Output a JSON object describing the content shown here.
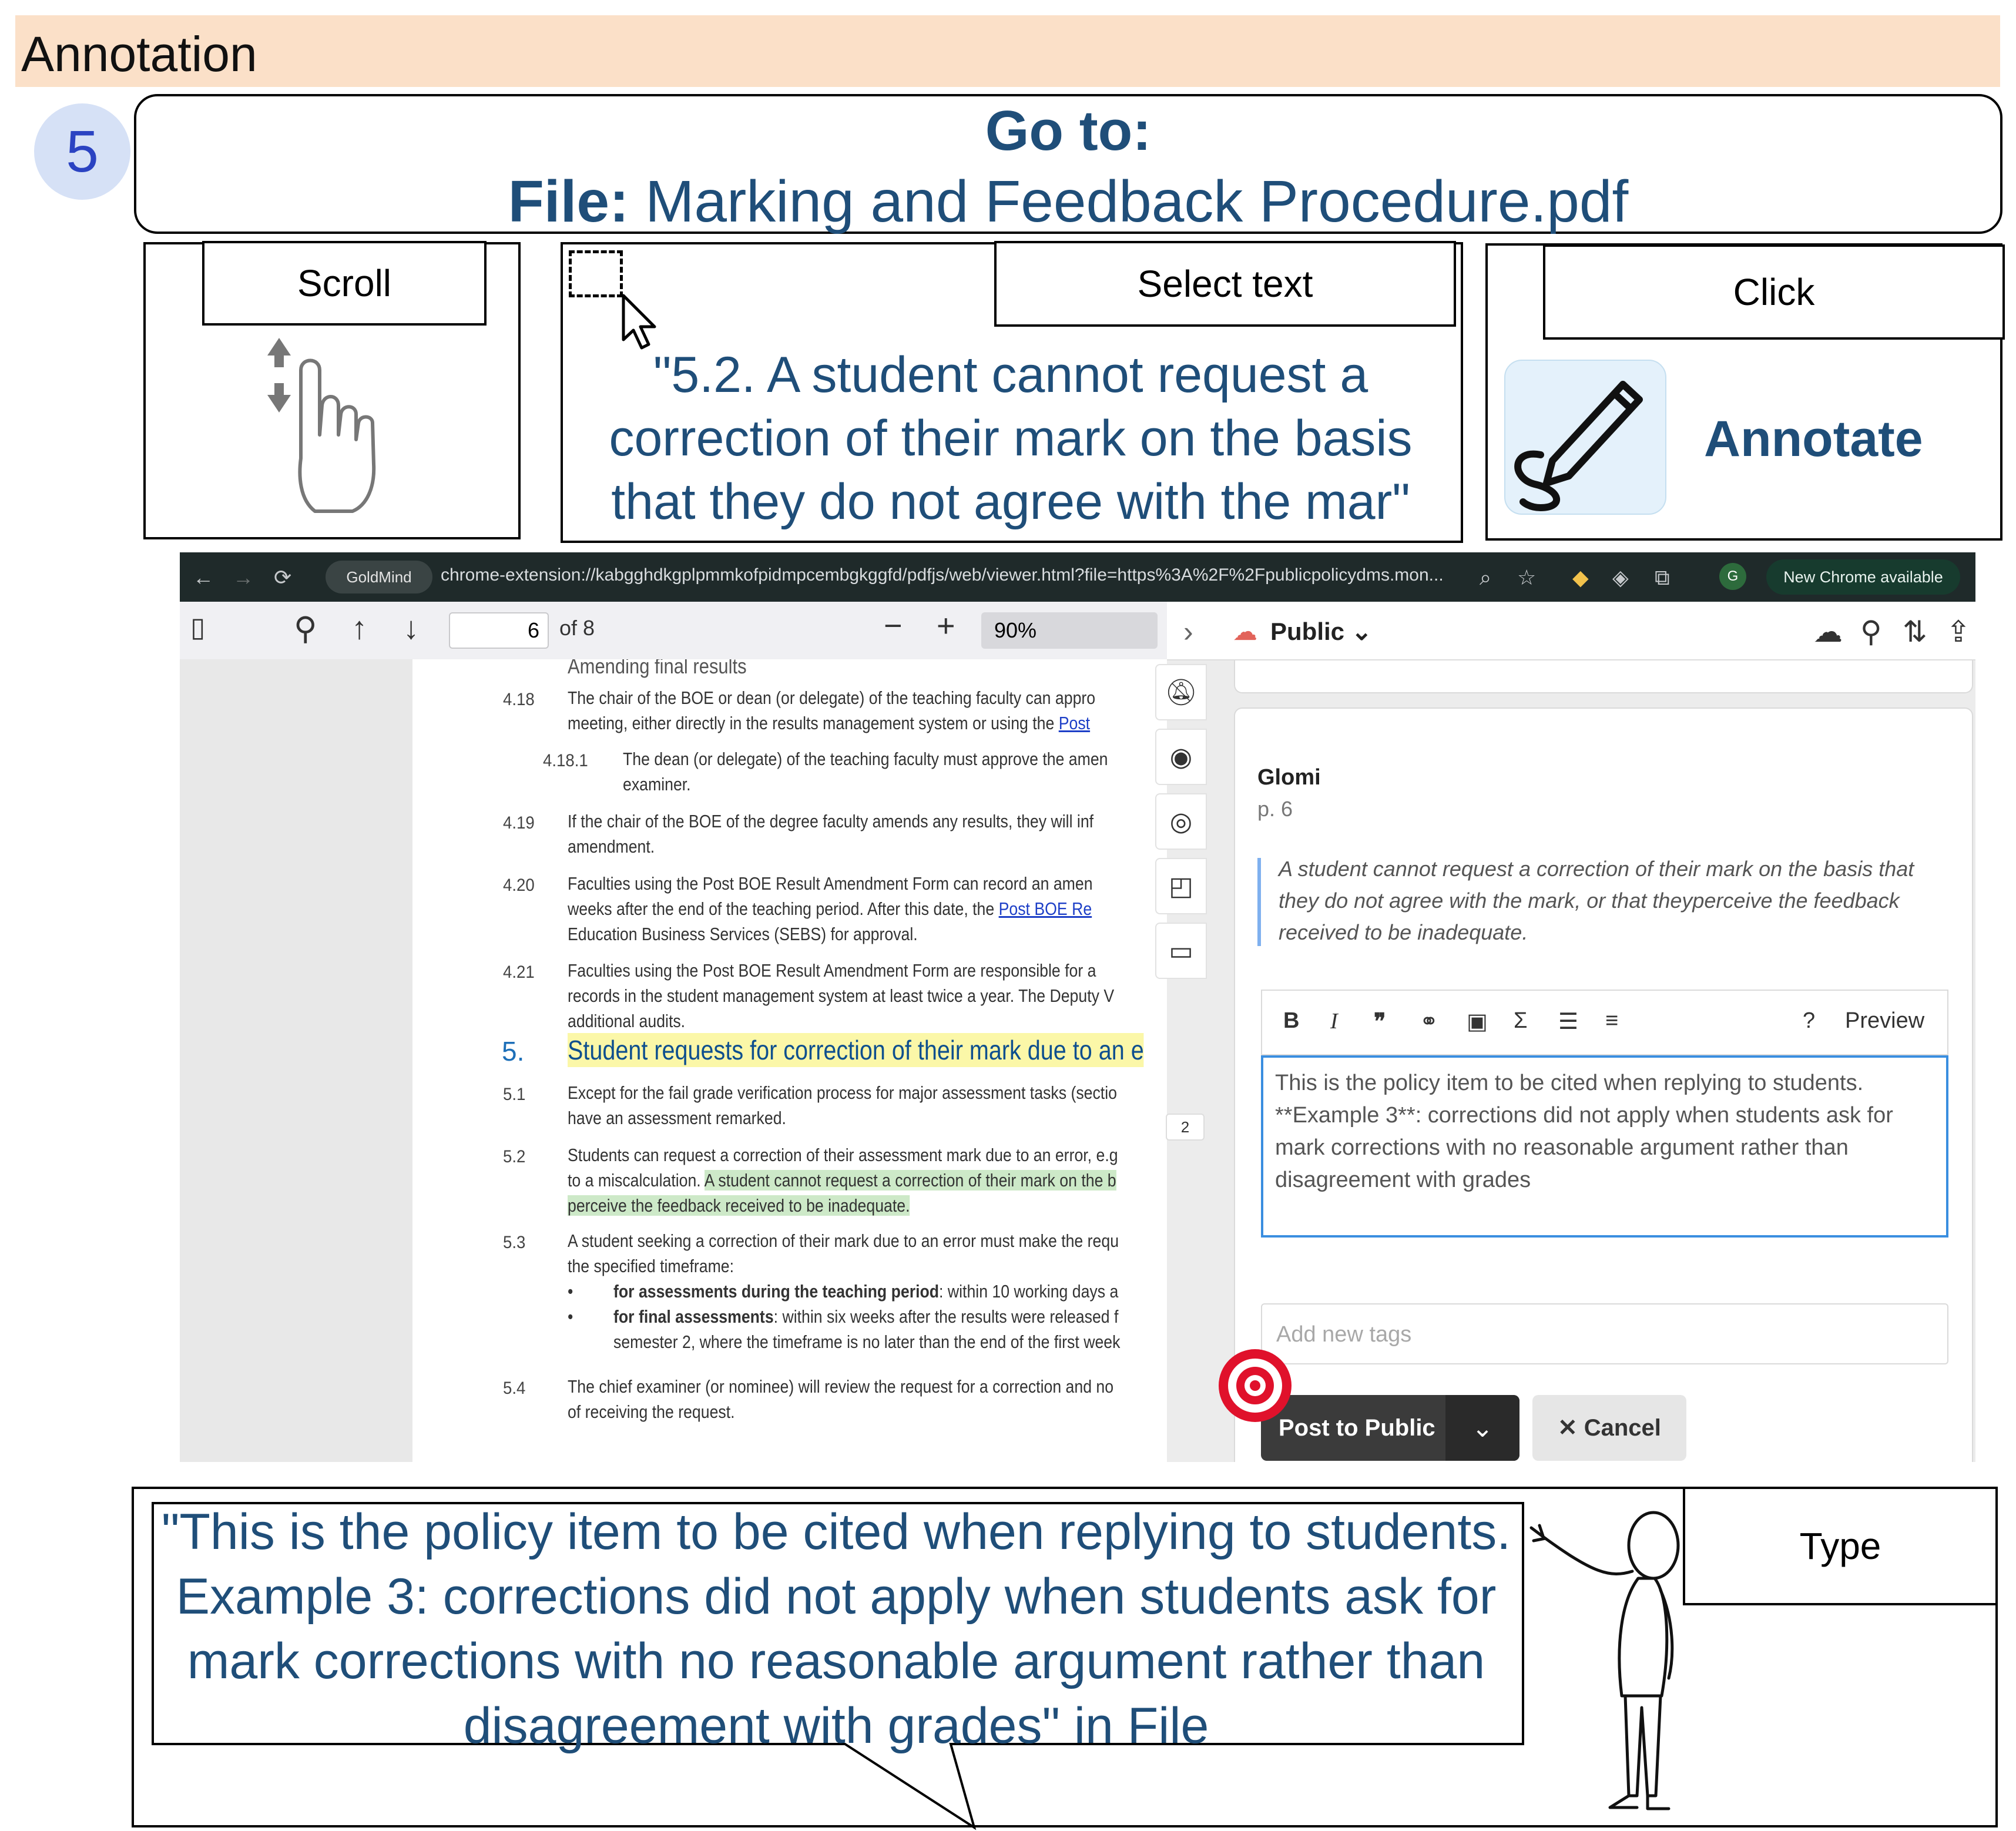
{
  "banner": {
    "title": "Annotation"
  },
  "step": {
    "number": "5"
  },
  "goto": {
    "title": "Go to:",
    "file_label": "File:",
    "file_name": "Marking and Feedback Procedure.pdf"
  },
  "actions": {
    "scroll_label": "Scroll",
    "select_label": "Select text",
    "select_quote": "\"5.2. A student cannot request a correction of their mark on the basis that they do not agree with the mar\"",
    "click_label": "Click",
    "annotate_label": "Annotate",
    "type_label": "Type",
    "type_text": "\"This is the policy item to be cited when replying to students. Example 3: corrections did not apply when students ask for mark corrections with no reasonable argument rather than disagreement with grades\" in File"
  },
  "browser": {
    "extension_chip": "GoldMind",
    "url": "chrome-extension://kabgghdkgplpmmkofpidmpcembgkggfd/pdfjs/web/viewer.html?file=https%3A%2F%2Fpublicpolicydms.mon...",
    "new_chrome": "New Chrome available",
    "profile_initial": "G"
  },
  "pdf_toolbar": {
    "page": "6",
    "page_count": "of 8",
    "zoom": "90%"
  },
  "pdf": {
    "heading_cut": "Amending final results",
    "rows": [
      {
        "num": "4.18",
        "lines": [
          "The chair of the BOE or dean (or delegate) of the teaching faculty can appro",
          "meeting, either directly in the results management system or using the "
        ],
        "link": "Post"
      },
      {
        "num": "4.18.1",
        "lines": [
          "The dean (or delegate) of the teaching faculty must approve the amen",
          "examiner."
        ]
      },
      {
        "num": "4.19",
        "lines": [
          "If the chair of the BOE of the degree faculty amends any results, they will inf",
          "amendment."
        ]
      },
      {
        "num": "4.20",
        "lines": [
          "Faculties using the Post BOE Result Amendment Form can record an amen",
          "weeks after the end of the teaching period. After this date, the ",
          "Education Business Services (SEBS) for approval."
        ],
        "link": "Post BOE Re"
      },
      {
        "num": "4.21",
        "lines": [
          "Faculties using the Post BOE Result Amendment Form are responsible for a",
          "records in the student management system at least twice a year. The Deputy V",
          "additional audits."
        ]
      }
    ],
    "section_num": "5.",
    "section_title": "Student requests for correction of their mark due to an e",
    "s51": {
      "num": "5.1",
      "lines": [
        "Except for the fail grade verification process for major assessment tasks (sectio",
        "have an assessment remarked."
      ]
    },
    "s52": {
      "num": "5.2",
      "line1": "Students can request a correction of their assessment mark due to an error, e.g",
      "line2a": "to a miscalculation. ",
      "line2b": "A student cannot request a correction of their mark on the b",
      "line3": "perceive the feedback received to be inadequate."
    },
    "s53": {
      "num": "5.3",
      "lines": [
        "A student seeking a correction of their mark due to an error must make the requ",
        "the specified timeframe:"
      ]
    },
    "bullet1_bold": "for assessments during the teaching period",
    "bullet1_rest": ": within 10 working days a",
    "bullet2_bold": "for final assessments",
    "bullet2_rest": ": within six weeks after the results were released f",
    "bullet2_line2": "semester 2, where the timeframe is no later than the end of the first week",
    "s54": {
      "num": "5.4",
      "lines": [
        "The chief examiner (or nominee) will review the request for a correction and no",
        "of receiving the request."
      ]
    },
    "annotation_count": "2"
  },
  "panel": {
    "group": "Public",
    "author": "Glomi",
    "page_ref": "p. 6",
    "quote": "A student cannot request a correction of their mark on the basis that they do not agree with the mark, or that theyperceive the feedback received to be inadequate.",
    "md_preview": "Preview",
    "md_help": "?",
    "editor_text": "This is the policy item to be cited when replying to students. **Example 3**: corrections did not apply when students ask for mark corrections with no reasonable argument rather than disagreement with grades",
    "tags_placeholder": "Add new tags",
    "post_button": "Post to Public",
    "cancel_button": "Cancel"
  },
  "icons": [
    "back-arrow-icon",
    "forward-arrow-icon",
    "reload-icon",
    "zoom-icon",
    "star-icon",
    "extension-icon",
    "sidebar-toggle-icon",
    "search-icon",
    "up-arrow-icon",
    "down-arrow-icon",
    "minus-icon",
    "plus-icon",
    "chevron-right-icon",
    "upload-cloud-icon",
    "sort-icon",
    "share-icon",
    "home-icon",
    "help-icon",
    "user-icon",
    "bell-off-icon",
    "record-icon",
    "eye-icon",
    "note-icon",
    "comment-icon",
    "bold-icon",
    "italic-icon",
    "quote-icon",
    "link-icon",
    "image-icon",
    "sigma-icon",
    "ordered-list-icon",
    "bullet-list-icon",
    "close-icon",
    "target-icon",
    "pencil-icon",
    "hand-scroll-icon",
    "cursor-icon",
    "person-pointing-icon"
  ],
  "colors": {
    "banner": "#fbe0c8",
    "navy_text": "#1f4e79",
    "badge": "#d6e1f6",
    "highlight_green": "#cde9c8",
    "highlight_yellow": "#fbf7a8",
    "editor_border": "#3a8ee0",
    "target_red": "#e0112b"
  }
}
